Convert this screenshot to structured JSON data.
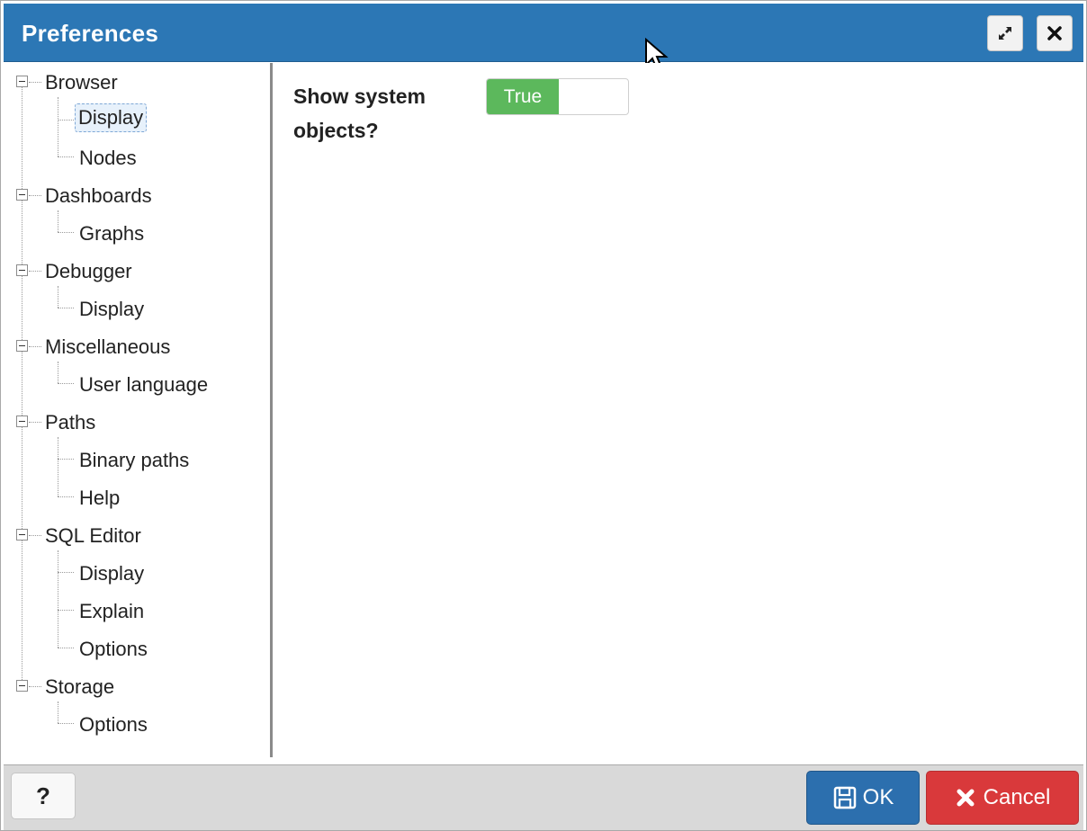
{
  "window": {
    "title": "Preferences",
    "maximize_icon": "expand-icon",
    "close_icon": "close-icon"
  },
  "tree": {
    "groups": [
      {
        "label": "Browser",
        "children": [
          "Display",
          "Nodes"
        ]
      },
      {
        "label": "Dashboards",
        "children": [
          "Graphs"
        ]
      },
      {
        "label": "Debugger",
        "children": [
          "Display"
        ]
      },
      {
        "label": "Miscellaneous",
        "children": [
          "User language"
        ]
      },
      {
        "label": "Paths",
        "children": [
          "Binary paths",
          "Help"
        ]
      },
      {
        "label": "SQL Editor",
        "children": [
          "Display",
          "Explain",
          "Options"
        ]
      },
      {
        "label": "Storage",
        "children": [
          "Options"
        ]
      }
    ],
    "selected": "Browser/Display"
  },
  "setting": {
    "label": "Show system objects?",
    "toggle_value": "True"
  },
  "footer": {
    "help_label": "?",
    "ok_label": "OK",
    "cancel_label": "Cancel"
  },
  "colors": {
    "titlebar": "#2c77b5",
    "toggle_on": "#5cb85c",
    "ok": "#2c6fae",
    "cancel": "#d9393b"
  }
}
